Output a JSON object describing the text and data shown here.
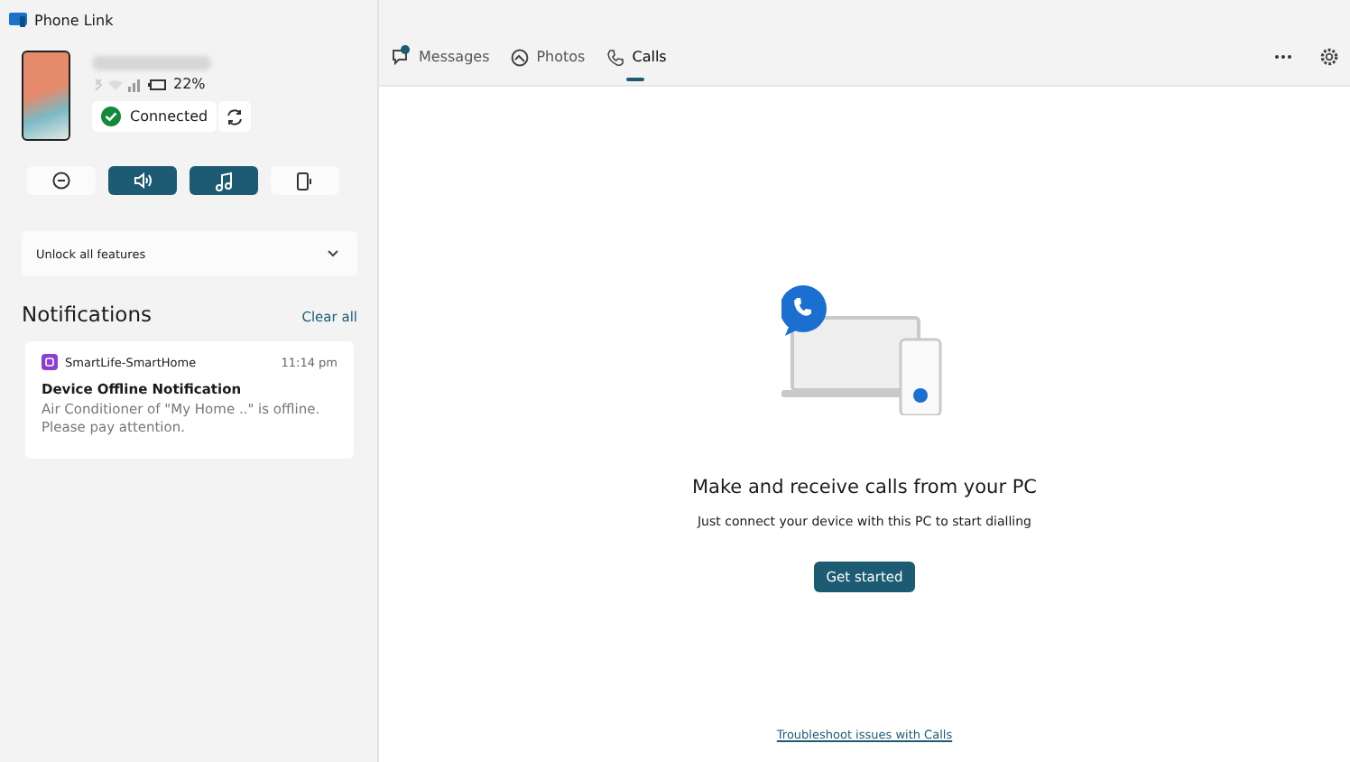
{
  "window": {
    "title": "Phone Link"
  },
  "device": {
    "battery": "22%",
    "status": "Connected"
  },
  "quick_actions": [
    {
      "kind": "dnd",
      "on": false
    },
    {
      "kind": "audio",
      "on": true
    },
    {
      "kind": "music",
      "on": true
    },
    {
      "kind": "cast",
      "on": false
    }
  ],
  "unlock": {
    "label": "Unlock all features"
  },
  "notifications": {
    "title": "Notifications",
    "clear": "Clear all",
    "items": [
      {
        "app": "SmartLife-SmartHome",
        "time": "11:14 pm",
        "title": "Device Offline Notification",
        "body": "Air Conditioner of \"My Home ..\" is offline. Please pay attention."
      }
    ]
  },
  "tabs": [
    {
      "kind": "messages",
      "label": "Messages",
      "selected": false
    },
    {
      "kind": "photos",
      "label": "Photos",
      "selected": false
    },
    {
      "kind": "calls",
      "label": "Calls",
      "selected": true
    }
  ],
  "calls": {
    "heading": "Make and receive calls from your PC",
    "subtitle": "Just connect your device with this PC to start dialling",
    "button": "Get started",
    "link": "Troubleshoot issues with Calls"
  }
}
